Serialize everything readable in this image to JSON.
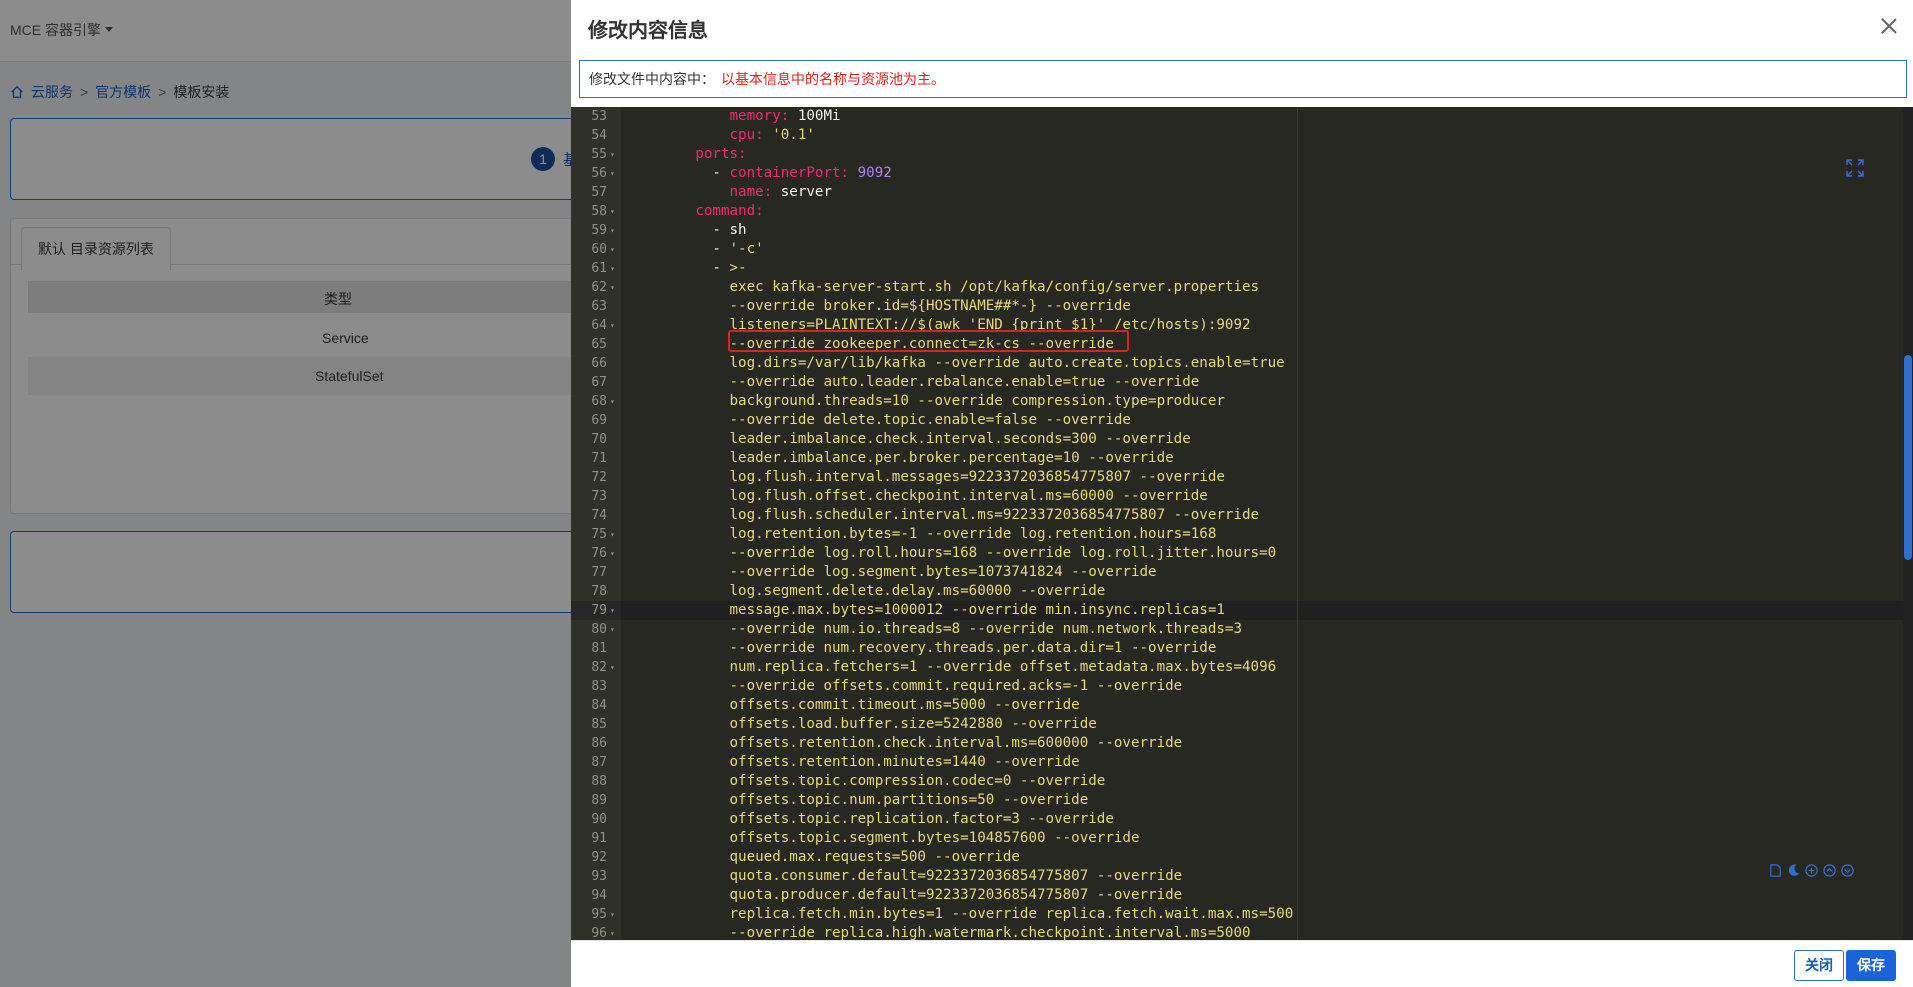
{
  "app": {
    "brand": "MCE 容器引擎"
  },
  "breadcrumb": {
    "home": "云服务",
    "templates": "官方模板",
    "current": "模板安装",
    "sep": ">"
  },
  "steps": {
    "step1_num": "1",
    "step1_label": "基"
  },
  "resource_panel": {
    "tab_label": "默认 目录资源列表",
    "column_type": "类型",
    "rows": [
      "Service",
      "StatefulSet"
    ]
  },
  "drawer": {
    "title": "修改内容信息",
    "notice_label": "修改文件中内容中：",
    "notice_message": "以基本信息中的名称与资源池为主。",
    "close_button": "关闭",
    "save_button": "保存"
  },
  "editor": {
    "highlighted_line": 65,
    "active_line": 79,
    "lines": [
      {
        "n": "53",
        "fold": false,
        "tokens": [
          [
            "plain",
            "            "
          ],
          [
            "key",
            "memory:"
          ],
          [
            "plain",
            " 100Mi"
          ]
        ]
      },
      {
        "n": "54",
        "fold": false,
        "tokens": [
          [
            "plain",
            "            "
          ],
          [
            "key",
            "cpu:"
          ],
          [
            "plain",
            " "
          ],
          [
            "str",
            "'0.1'"
          ]
        ]
      },
      {
        "n": "55",
        "fold": true,
        "tokens": [
          [
            "plain",
            "        "
          ],
          [
            "key",
            "ports:"
          ]
        ]
      },
      {
        "n": "56",
        "fold": true,
        "tokens": [
          [
            "plain",
            "          - "
          ],
          [
            "key",
            "containerPort:"
          ],
          [
            "plain",
            " "
          ],
          [
            "num",
            "9092"
          ]
        ]
      },
      {
        "n": "57",
        "fold": false,
        "tokens": [
          [
            "plain",
            "            "
          ],
          [
            "key",
            "name:"
          ],
          [
            "plain",
            " server"
          ]
        ]
      },
      {
        "n": "58",
        "fold": true,
        "tokens": [
          [
            "plain",
            "        "
          ],
          [
            "key",
            "command:"
          ]
        ]
      },
      {
        "n": "59",
        "fold": true,
        "tokens": [
          [
            "plain",
            "          - sh"
          ]
        ]
      },
      {
        "n": "60",
        "fold": true,
        "tokens": [
          [
            "plain",
            "          - "
          ],
          [
            "str",
            "'-c'"
          ]
        ]
      },
      {
        "n": "61",
        "fold": true,
        "tokens": [
          [
            "plain",
            "          - "
          ],
          [
            "str",
            ">-"
          ]
        ]
      },
      {
        "n": "62",
        "fold": true,
        "tokens": [
          [
            "plain",
            "            "
          ],
          [
            "str",
            "exec kafka-server-start.sh /opt/kafka/config/server.properties"
          ]
        ]
      },
      {
        "n": "63",
        "fold": false,
        "tokens": [
          [
            "plain",
            "            "
          ],
          [
            "str",
            "--override broker.id=${HOSTNAME##*-} --override"
          ]
        ]
      },
      {
        "n": "64",
        "fold": true,
        "tokens": [
          [
            "plain",
            "            "
          ],
          [
            "str",
            "listeners=PLAINTEXT://$(awk 'END {print $1}' /etc/hosts):9092"
          ]
        ]
      },
      {
        "n": "65",
        "fold": false,
        "tokens": [
          [
            "plain",
            "            "
          ],
          [
            "str",
            "--override zookeeper.connect=zk-cs --override"
          ]
        ]
      },
      {
        "n": "66",
        "fold": false,
        "tokens": [
          [
            "plain",
            "            "
          ],
          [
            "str",
            "log.dirs=/var/lib/kafka --override auto.create.topics.enable=true"
          ]
        ]
      },
      {
        "n": "67",
        "fold": false,
        "tokens": [
          [
            "plain",
            "            "
          ],
          [
            "str",
            "--override auto.leader.rebalance.enable=true --override"
          ]
        ]
      },
      {
        "n": "68",
        "fold": true,
        "tokens": [
          [
            "plain",
            "            "
          ],
          [
            "str",
            "background.threads=10 --override compression.type=producer"
          ]
        ]
      },
      {
        "n": "69",
        "fold": false,
        "tokens": [
          [
            "plain",
            "            "
          ],
          [
            "str",
            "--override delete.topic.enable=false --override"
          ]
        ]
      },
      {
        "n": "70",
        "fold": false,
        "tokens": [
          [
            "plain",
            "            "
          ],
          [
            "str",
            "leader.imbalance.check.interval.seconds=300 --override"
          ]
        ]
      },
      {
        "n": "71",
        "fold": false,
        "tokens": [
          [
            "plain",
            "            "
          ],
          [
            "str",
            "leader.imbalance.per.broker.percentage=10 --override"
          ]
        ]
      },
      {
        "n": "72",
        "fold": false,
        "tokens": [
          [
            "plain",
            "            "
          ],
          [
            "str",
            "log.flush.interval.messages=9223372036854775807 --override"
          ]
        ]
      },
      {
        "n": "73",
        "fold": false,
        "tokens": [
          [
            "plain",
            "            "
          ],
          [
            "str",
            "log.flush.offset.checkpoint.interval.ms=60000 --override"
          ]
        ]
      },
      {
        "n": "74",
        "fold": false,
        "tokens": [
          [
            "plain",
            "            "
          ],
          [
            "str",
            "log.flush.scheduler.interval.ms=9223372036854775807 --override"
          ]
        ]
      },
      {
        "n": "75",
        "fold": true,
        "tokens": [
          [
            "plain",
            "            "
          ],
          [
            "str",
            "log.retention.bytes=-1 --override log.retention.hours=168"
          ]
        ]
      },
      {
        "n": "76",
        "fold": true,
        "tokens": [
          [
            "plain",
            "            "
          ],
          [
            "str",
            "--override log.roll.hours=168 --override log.roll.jitter.hours=0"
          ]
        ]
      },
      {
        "n": "77",
        "fold": false,
        "tokens": [
          [
            "plain",
            "            "
          ],
          [
            "str",
            "--override log.segment.bytes=1073741824 --override"
          ]
        ]
      },
      {
        "n": "78",
        "fold": false,
        "tokens": [
          [
            "plain",
            "            "
          ],
          [
            "str",
            "log.segment.delete.delay.ms=60000 --override"
          ]
        ]
      },
      {
        "n": "79",
        "fold": true,
        "tokens": [
          [
            "plain",
            "            "
          ],
          [
            "str",
            "message.max.bytes=1000012 --override min.insync.replicas=1"
          ]
        ]
      },
      {
        "n": "80",
        "fold": true,
        "tokens": [
          [
            "plain",
            "            "
          ],
          [
            "str",
            "--override num.io.threads=8 --override num.network.threads=3"
          ]
        ]
      },
      {
        "n": "81",
        "fold": false,
        "tokens": [
          [
            "plain",
            "            "
          ],
          [
            "str",
            "--override num.recovery.threads.per.data.dir=1 --override"
          ]
        ]
      },
      {
        "n": "82",
        "fold": true,
        "tokens": [
          [
            "plain",
            "            "
          ],
          [
            "str",
            "num.replica.fetchers=1 --override offset.metadata.max.bytes=4096"
          ]
        ]
      },
      {
        "n": "83",
        "fold": false,
        "tokens": [
          [
            "plain",
            "            "
          ],
          [
            "str",
            "--override offsets.commit.required.acks=-1 --override"
          ]
        ]
      },
      {
        "n": "84",
        "fold": false,
        "tokens": [
          [
            "plain",
            "            "
          ],
          [
            "str",
            "offsets.commit.timeout.ms=5000 --override"
          ]
        ]
      },
      {
        "n": "85",
        "fold": false,
        "tokens": [
          [
            "plain",
            "            "
          ],
          [
            "str",
            "offsets.load.buffer.size=5242880 --override"
          ]
        ]
      },
      {
        "n": "86",
        "fold": false,
        "tokens": [
          [
            "plain",
            "            "
          ],
          [
            "str",
            "offsets.retention.check.interval.ms=600000 --override"
          ]
        ]
      },
      {
        "n": "87",
        "fold": false,
        "tokens": [
          [
            "plain",
            "            "
          ],
          [
            "str",
            "offsets.retention.minutes=1440 --override"
          ]
        ]
      },
      {
        "n": "88",
        "fold": false,
        "tokens": [
          [
            "plain",
            "            "
          ],
          [
            "str",
            "offsets.topic.compression.codec=0 --override"
          ]
        ]
      },
      {
        "n": "89",
        "fold": false,
        "tokens": [
          [
            "plain",
            "            "
          ],
          [
            "str",
            "offsets.topic.num.partitions=50 --override"
          ]
        ]
      },
      {
        "n": "90",
        "fold": false,
        "tokens": [
          [
            "plain",
            "            "
          ],
          [
            "str",
            "offsets.topic.replication.factor=3 --override"
          ]
        ]
      },
      {
        "n": "91",
        "fold": false,
        "tokens": [
          [
            "plain",
            "            "
          ],
          [
            "str",
            "offsets.topic.segment.bytes=104857600 --override"
          ]
        ]
      },
      {
        "n": "92",
        "fold": false,
        "tokens": [
          [
            "plain",
            "            "
          ],
          [
            "str",
            "queued.max.requests=500 --override"
          ]
        ]
      },
      {
        "n": "93",
        "fold": false,
        "tokens": [
          [
            "plain",
            "            "
          ],
          [
            "str",
            "quota.consumer.default=9223372036854775807 --override"
          ]
        ]
      },
      {
        "n": "94",
        "fold": false,
        "tokens": [
          [
            "plain",
            "            "
          ],
          [
            "str",
            "quota.producer.default=9223372036854775807 --override"
          ]
        ]
      },
      {
        "n": "95",
        "fold": true,
        "tokens": [
          [
            "plain",
            "            "
          ],
          [
            "str",
            "replica.fetch.min.bytes=1 --override replica.fetch.wait.max.ms=500"
          ]
        ]
      },
      {
        "n": "96",
        "fold": true,
        "tokens": [
          [
            "plain",
            "            "
          ],
          [
            "str",
            "--override replica.high.watermark.checkpoint.interval.ms=5000"
          ]
        ]
      }
    ]
  },
  "colors": {
    "accent": "#1a63d8",
    "notice_red": "#e02020",
    "editor_bg": "#272822",
    "yaml_key": "#f92672",
    "yaml_string": "#e6db74",
    "yaml_number": "#ae81ff"
  },
  "icons": [
    "home-icon",
    "close-icon",
    "expand-icon",
    "file-icon",
    "moon-icon",
    "settings-icon",
    "scroll-up-icon",
    "scroll-down-icon"
  ]
}
